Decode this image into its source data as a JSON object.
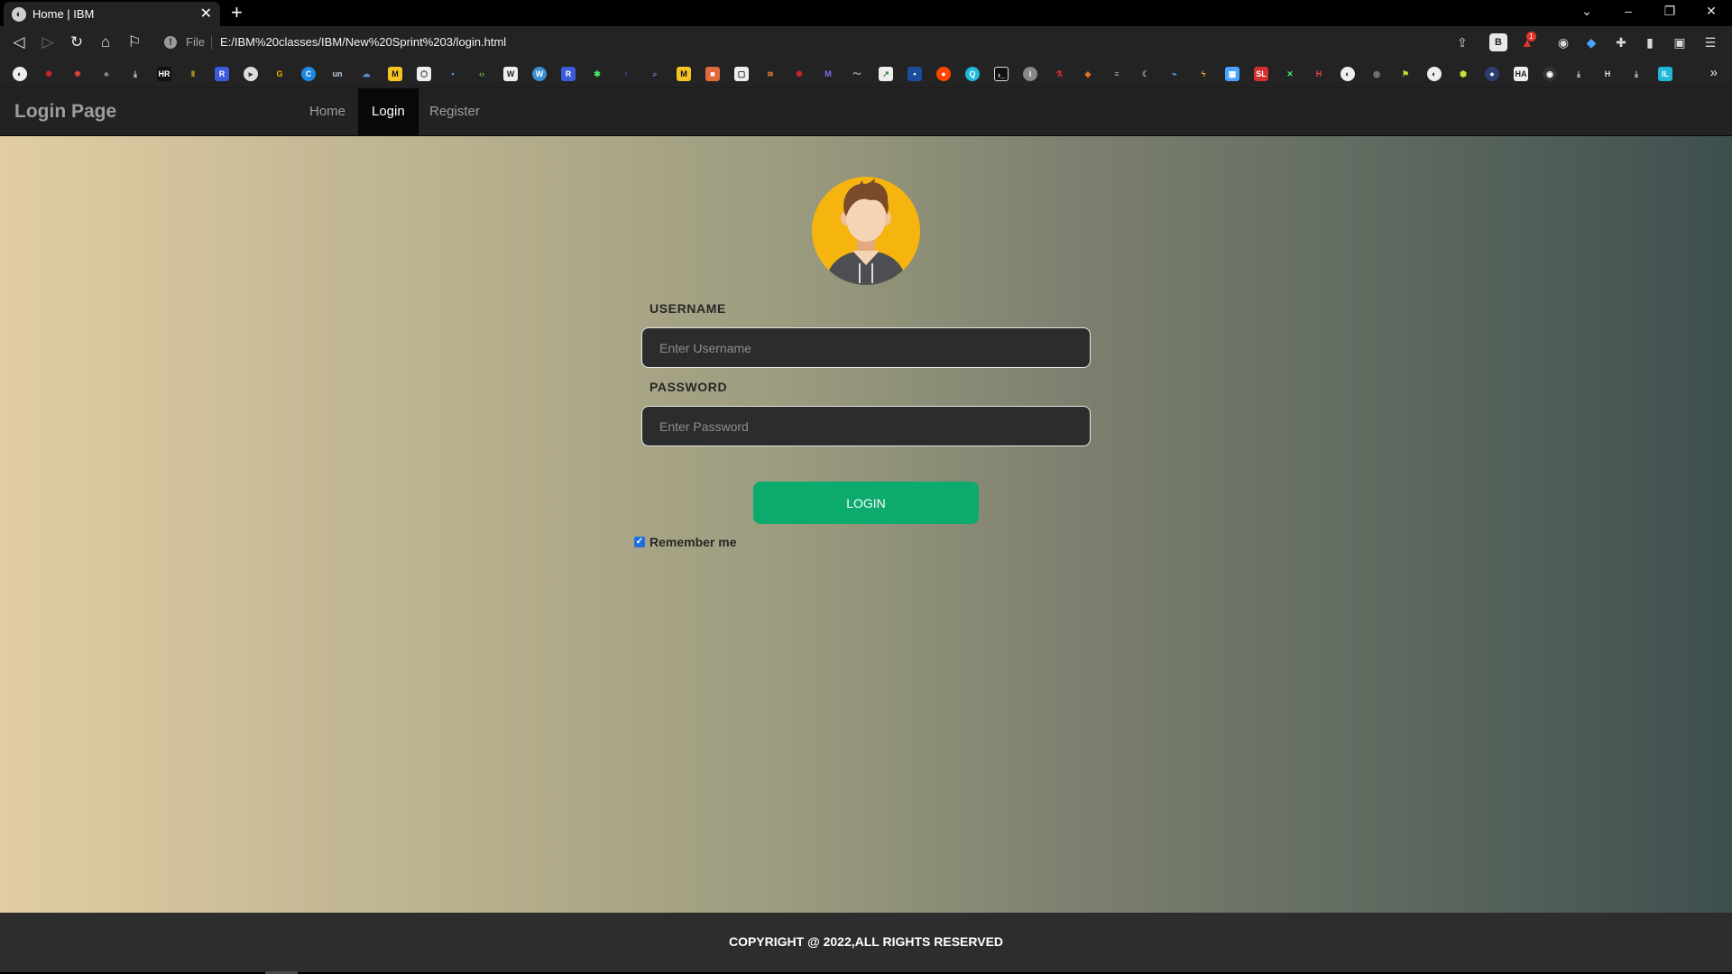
{
  "browser": {
    "tab_title": "Home | IBM",
    "file_label": "File",
    "url": "E:/IBM%20classes/IBM/New%20Sprint%203/login.html",
    "rewards_count": "1"
  },
  "site": {
    "brand": "Login Page",
    "nav": [
      "Home",
      "Login",
      "Register"
    ],
    "active_nav": "Login"
  },
  "form": {
    "username_label": "USERNAME",
    "username_placeholder": "Enter Username",
    "password_label": "PASSWORD",
    "password_placeholder": "Enter Password",
    "login_button": "LOGIN",
    "remember_label": "Remember me",
    "remember_checked": true
  },
  "footer": {
    "text": "COPYRIGHT @ 2022,ALL RIGHTS RESERVED"
  },
  "colors": {
    "accent_green": "#0caa6d",
    "avatar_bg": "#f6b40f",
    "navbar_bg": "#222222",
    "gradient_left": "#e2cda3",
    "gradient_right": "#3d4f4e"
  }
}
